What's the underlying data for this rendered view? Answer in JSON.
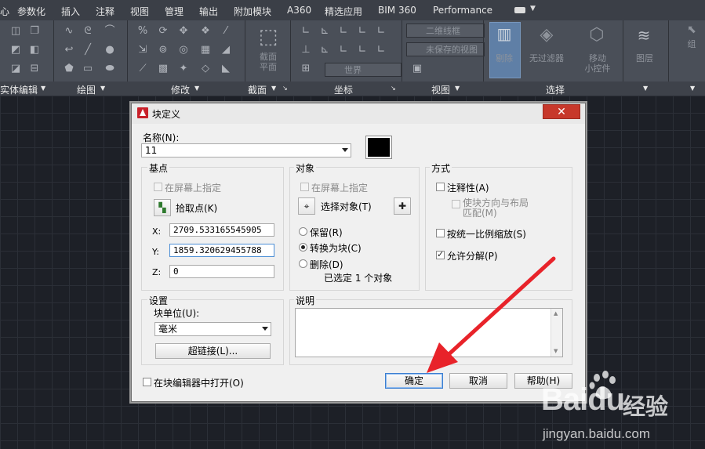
{
  "menubar": {
    "items": [
      "心",
      "参数化",
      "插入",
      "注释",
      "视图",
      "管理",
      "输出",
      "附加模块",
      "A360",
      "精选应用",
      "BIM 360",
      "Performance"
    ]
  },
  "ribbon": {
    "panels": [
      "实体编辑",
      "绘图",
      "修改",
      "截面",
      "坐标",
      "视图",
      "选择"
    ],
    "big_buttons": {
      "section_plane": "截面\n平面",
      "no_filter": "无过滤器",
      "move_gizmo": "移动\n小控件",
      "layers": "图层",
      "group": "组"
    },
    "combos": {
      "visual_style": "二维线框",
      "view_unsaved": "未保存的视图",
      "ucs_world": "世界"
    }
  },
  "dialog": {
    "title": "块定义",
    "name_label": "名称(N):",
    "name_value": "11",
    "base_point": {
      "title": "基点",
      "specify_on_screen": "在屏幕上指定",
      "pick_point": "拾取点(K)",
      "x_label": "X:",
      "x_value": "2709.533165545905",
      "y_label": "Y:",
      "y_value": "1859.320629455788",
      "z_label": "Z:",
      "z_value": "0"
    },
    "objects": {
      "title": "对象",
      "specify_on_screen": "在屏幕上指定",
      "select_objects": "选择对象(T)",
      "retain": "保留(R)",
      "convert_to_block": "转换为块(C)",
      "delete": "删除(D)",
      "selected_count": "已选定 1 个对象"
    },
    "behavior": {
      "title": "方式",
      "annotative": "注释性(A)",
      "match_orientation": "使块方向与布局\n匹配(M)",
      "scale_uniformly": "按统一比例缩放(S)",
      "allow_exploding": "允许分解(P)"
    },
    "settings": {
      "title": "设置",
      "block_unit_label": "块单位(U):",
      "block_unit_value": "毫米",
      "hyperlink": "超链接(L)..."
    },
    "description": {
      "title": "说明",
      "value": ""
    },
    "open_in_editor": "在块编辑器中打开(O)",
    "ok": "确定",
    "cancel": "取消",
    "help": "帮助(H)"
  },
  "watermark": {
    "brand": "Baidu",
    "cn": "经验",
    "url": "jingyan.baidu.com"
  },
  "colors": {
    "arrow": "#e8232a",
    "close": "#c7382b",
    "canvas": "#1d2027"
  }
}
